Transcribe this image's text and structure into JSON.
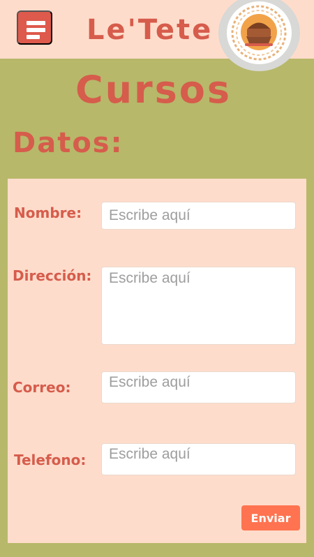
{
  "header": {
    "brand": "Le'Tete",
    "menu_icon": "hamburger-menu-icon",
    "logo_icon": "cake-logo-icon"
  },
  "page": {
    "title": "Cursos",
    "section_title": "Datos:"
  },
  "form": {
    "fields": [
      {
        "label": "Nombre:",
        "placeholder": "Escribe aquí"
      },
      {
        "label": "Dirección:",
        "placeholder": "Escribe aquí"
      },
      {
        "label": "Correo:",
        "placeholder": "Escribe aquí"
      },
      {
        "label": "Telefono:",
        "placeholder": "Escribe aquí"
      }
    ],
    "submit_label": "Enviar"
  },
  "colors": {
    "background": "#b7b86a",
    "header": "#fedccb",
    "accent": "#d65c4c",
    "button": "#ff7350"
  }
}
